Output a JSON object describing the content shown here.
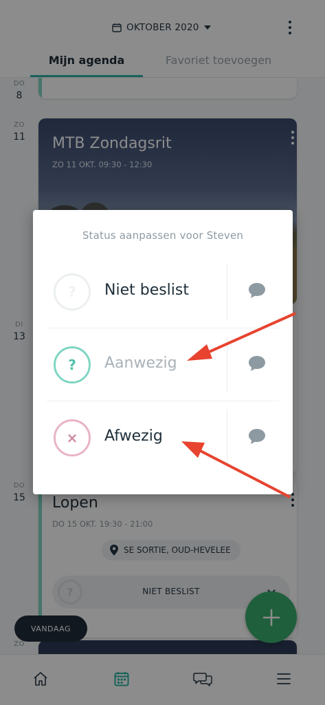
{
  "header": {
    "month": "OKTOBER 2020",
    "tabs": [
      "Mijn agenda",
      "Favoriet toevoegen"
    ]
  },
  "agenda": {
    "dates": [
      {
        "dow": "DO",
        "day": "8"
      },
      {
        "dow": "ZO",
        "day": "11"
      },
      {
        "dow": "DI",
        "day": "13"
      },
      {
        "dow": "DO",
        "day": "15"
      },
      {
        "dow": "ZO",
        "day": ""
      }
    ],
    "event_photo": {
      "title": "MTB Zondagsrit",
      "time": "ZO 11 OKT. 09:30 - 12:30"
    },
    "event_lopen": {
      "title": "Lopen",
      "time": "DO 15 OKT. 19:30 - 21:00",
      "location": "SE SORTIE, OUD-HEVELEE",
      "status": "NIET BESLIST"
    }
  },
  "today_button": "VANDAAG",
  "dialog": {
    "title": "Status aanpassen voor Steven",
    "options": [
      {
        "label": "Niet beslist",
        "symbol": "?",
        "icon": "question-circle-icon"
      },
      {
        "label": "Aanwezig",
        "symbol": "?",
        "icon": "question-circle-icon"
      },
      {
        "label": "Afwezig",
        "symbol": "×",
        "icon": "cross-circle-icon"
      }
    ]
  },
  "bottom_nav": [
    "home-icon",
    "calendar-icon",
    "chat-icon",
    "menu-icon"
  ],
  "colors": {
    "accent": "#2bb3a3",
    "fab": "#3aad6d",
    "arrow": "#e8432f",
    "present": "#7fd6c3",
    "absent": "#e9b3c6"
  }
}
